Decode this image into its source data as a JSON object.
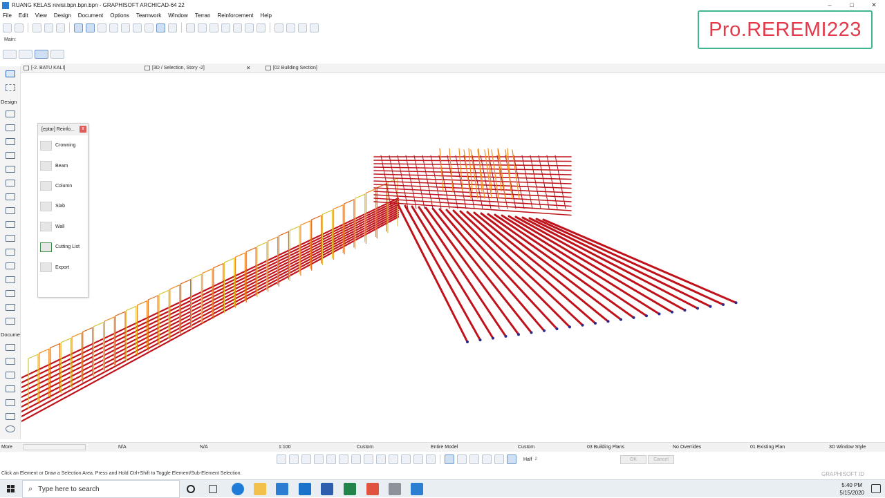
{
  "window": {
    "title": "RUANG KELAS revisi.bpn.bpn.bpn - GRAPHISOFT ARCHICAD-64 22",
    "min": "–",
    "max": "□",
    "close": "✕"
  },
  "menu": [
    "File",
    "Edit",
    "View",
    "Design",
    "Document",
    "Options",
    "Teamwork",
    "Window",
    "Terran",
    "Reinforcement",
    "Help"
  ],
  "toolbar": {
    "main_label": "Main:"
  },
  "brand": {
    "text": "Pro.REREMI223",
    "color": "#e23a4a",
    "border": "#3fb58c"
  },
  "tabs": [
    {
      "label": "[-2. BATU KALI]"
    },
    {
      "label": "[3D / Selection, Story -2]",
      "close": "✕"
    },
    {
      "label": "[02 Building Section]"
    }
  ],
  "toolbox": {
    "design_label": "Design",
    "document_label": "Docume",
    "more_label": "More"
  },
  "palette": {
    "title": "[eptar] Reinfo...",
    "close": "x",
    "items": [
      "Crowning",
      "Beam",
      "Column",
      "Slab",
      "Wall",
      "Cutting List",
      "Export"
    ]
  },
  "statusbar": {
    "na1": "N/A",
    "na2": "N/A",
    "scale": "1:100",
    "custom1": "Custom",
    "model": "Entire Model",
    "custom2": "Custom",
    "plans": "03 Building Plans",
    "overrides": "No Overrides",
    "existing": "01 Existing Plan",
    "style": "3D Window Style",
    "half": "Half",
    "half_sub": "2",
    "ok": "OK",
    "cancel": "Cancel"
  },
  "hint": "Click an Element or Draw a Selection Area. Press and Hold Ctrl+Shift to Toggle Element/Sub-Element Selection.",
  "graphisoft": "GRAPHISOFT ID",
  "taskbar": {
    "search_placeholder": "Type here to search",
    "time": "5:40 PM",
    "date": "5/15/2020"
  },
  "colors": {
    "rebar_red": "#c0121a",
    "rebar_orange": "#f08a1e",
    "rebar_yellow": "#d7c63a"
  }
}
